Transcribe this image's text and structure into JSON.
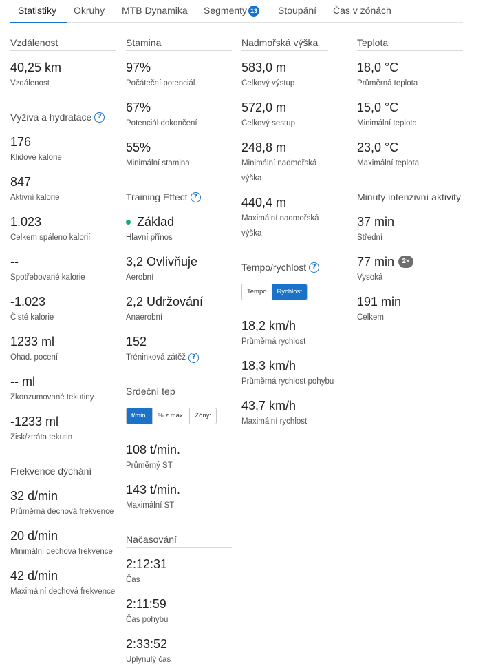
{
  "tabs": [
    {
      "label": "Statistiky"
    },
    {
      "label": "Okruhy"
    },
    {
      "label": "MTB Dynamika"
    },
    {
      "label": "Segmenty",
      "badge": "13"
    },
    {
      "label": "Stoupání"
    },
    {
      "label": "Čas v zónách"
    }
  ],
  "distance": {
    "title": "Vzdálenost",
    "value": "40,25 km",
    "label": "Vzdálenost"
  },
  "nutrition": {
    "title": "Výživa a hydratace",
    "items": [
      {
        "value": "176",
        "label": "Klidové kalorie"
      },
      {
        "value": "847",
        "label": "Aktivní kalorie"
      },
      {
        "value": "1.023",
        "label": "Celkem spáleno kalorií"
      },
      {
        "value": "--",
        "label": "Spotřebované kalorie"
      },
      {
        "value": "-1.023",
        "label": "Čisté kalorie"
      },
      {
        "value": "1233 ml",
        "label": "Ohad. pocení"
      },
      {
        "value": "-- ml",
        "label": "Zkonzumované tekutiny"
      },
      {
        "value": "-1233 ml",
        "label": "Zisk/ztráta tekutin"
      }
    ]
  },
  "breathing": {
    "title": "Frekvence dýchání",
    "items": [
      {
        "value": "32 d/min",
        "label": "Průměrná dechová frekvence"
      },
      {
        "value": "20 d/min",
        "label": "Minimální dechová frekvence"
      },
      {
        "value": "42 d/min",
        "label": "Maximální dechová frekvence"
      }
    ]
  },
  "stamina": {
    "title": "Stamina",
    "items": [
      {
        "value": "97%",
        "label": "Počáteční potenciál"
      },
      {
        "value": "67%",
        "label": "Potenciál dokončení"
      },
      {
        "value": "55%",
        "label": "Minimální stamina"
      }
    ]
  },
  "training_effect": {
    "title": "Training Effect",
    "primary": {
      "value": "Základ",
      "label": "Hlavní přínos"
    },
    "aerobic": {
      "value": "3,2 Ovlivňuje",
      "label": "Aerobní"
    },
    "anaerobic": {
      "value": "2,2 Udržování",
      "label": "Anaerobní"
    },
    "load": {
      "value": "152",
      "label": "Tréninková zátěž"
    }
  },
  "heart_rate": {
    "title": "Srdeční tep",
    "toggle": [
      "t/min.",
      "% z max.",
      "Zóny:"
    ],
    "items": [
      {
        "value": "108 t/min.",
        "label": "Průměrný ST"
      },
      {
        "value": "143 t/min.",
        "label": "Maximální ST"
      }
    ]
  },
  "timing": {
    "title": "Načasování",
    "items": [
      {
        "value": "2:12:31",
        "label": "Čas"
      },
      {
        "value": "2:11:59",
        "label": "Čas pohybu"
      },
      {
        "value": "2:33:52",
        "label": "Uplynulý čas"
      }
    ]
  },
  "elevation": {
    "title": "Nadmořská výška",
    "items": [
      {
        "value": "583,0 m",
        "label": "Celkový výstup"
      },
      {
        "value": "572,0 m",
        "label": "Celkový sestup"
      },
      {
        "value": "248,8 m",
        "label": "Minimální nadmořská výška"
      },
      {
        "value": "440,4 m",
        "label": "Maximální nadmořská výška"
      }
    ]
  },
  "pace": {
    "title": "Tempo/rychlost",
    "toggle": [
      "Tempo",
      "Rychlost"
    ],
    "items": [
      {
        "value": "18,2 km/h",
        "label": "Průměrná rychlost"
      },
      {
        "value": "18,3 km/h",
        "label": "Průměrná rychlost pohybu"
      },
      {
        "value": "43,7 km/h",
        "label": "Maximální rychlost"
      }
    ]
  },
  "temperature": {
    "title": "Teplota",
    "items": [
      {
        "value": "18,0 °C",
        "label": "Průměrná teplota"
      },
      {
        "value": "15,0 °C",
        "label": "Minimální teplota"
      },
      {
        "value": "23,0 °C",
        "label": "Maximální teplota"
      }
    ]
  },
  "intensity": {
    "title": "Minuty intenzivní aktivity",
    "moderate": {
      "value": "37 min",
      "label": "Střední"
    },
    "vigorous": {
      "value": "77 min",
      "label": "Vysoká",
      "multiplier": "2×"
    },
    "total": {
      "value": "191 min",
      "label": "Celkem"
    }
  },
  "colors": {
    "accent": "#1a73c9",
    "primary_benefit_dot": "#19a974"
  }
}
